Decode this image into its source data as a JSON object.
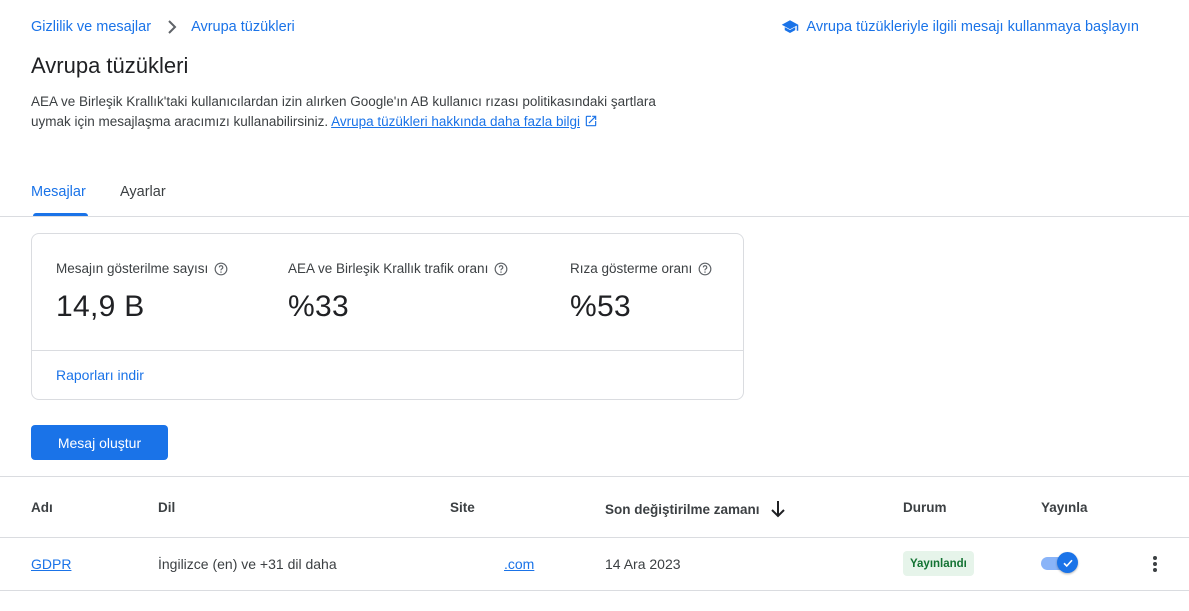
{
  "breadcrumb": {
    "root": "Gizlilik ve mesajlar",
    "current": "Avrupa tüzükleri"
  },
  "help_link": "Avrupa tüzükleriyle ilgili mesajı kullanmaya başlayın",
  "page_title": "Avrupa tüzükleri",
  "description": {
    "text": "AEA ve Birleşik Krallık'taki kullanıcılardan izin alırken Google'ın AB kullanıcı rızası politikasındaki şartlara uymak için mesajlaşma aracımızı kullanabilirsiniz.",
    "link": "Avrupa tüzükleri hakkında daha fazla bilgi"
  },
  "tabs": [
    {
      "label": "Mesajlar",
      "active": true
    },
    {
      "label": "Ayarlar",
      "active": false
    }
  ],
  "stats": [
    {
      "label": "Mesajın gösterilme sayısı",
      "value": "14,9 B"
    },
    {
      "label": "AEA ve Birleşik Krallık trafik oranı",
      "value": "%33"
    },
    {
      "label": "Rıza gösterme oranı",
      "value": "%53"
    }
  ],
  "download_reports": "Raporları indir",
  "create_button": "Mesaj oluştur",
  "table": {
    "headers": {
      "name": "Adı",
      "language": "Dil",
      "site": "Site",
      "modified": "Son değiştirilme zamanı",
      "status": "Durum",
      "publish": "Yayınla"
    },
    "rows": [
      {
        "name": "GDPR",
        "language": "İngilizce (en) ve +31 dil daha",
        "site": ".com",
        "modified": "14 Ara 2023",
        "status": "Yayınlandı",
        "published": true
      }
    ]
  },
  "colors": {
    "accent": "#1a73e8",
    "status_bg": "#e6f4ea",
    "status_text": "#137333"
  },
  "icons": {
    "breadcrumb_separator": "chevron-right-icon",
    "help_link": "school-icon",
    "external_link": "open-in-new-icon",
    "stat_help": "help-outline-icon",
    "sort": "arrow-downward-icon",
    "row_menu": "more-vert-icon"
  }
}
